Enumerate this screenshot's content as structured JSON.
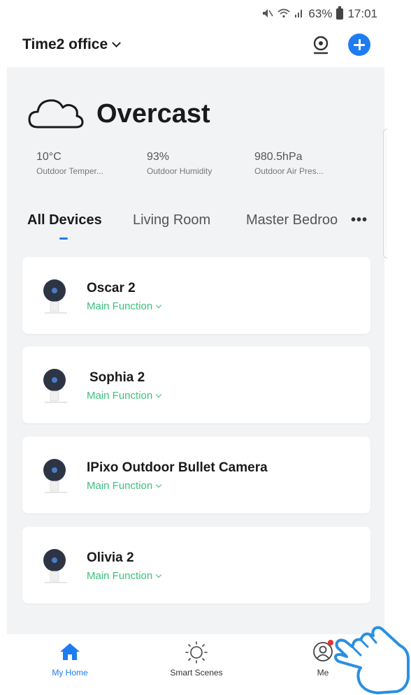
{
  "status_bar": {
    "battery": "63%",
    "time": "17:01"
  },
  "header": {
    "home_name": "Time2 office"
  },
  "weather": {
    "condition": "Overcast",
    "stats": [
      {
        "value": "10°C",
        "label": "Outdoor Temper..."
      },
      {
        "value": "93%",
        "label": "Outdoor Humidity"
      },
      {
        "value": "980.5hPa",
        "label": "Outdoor Air Pres..."
      }
    ]
  },
  "tabs": [
    "All Devices",
    "Living Room",
    "Master Bedroo"
  ],
  "devices": [
    {
      "name": "Oscar 2",
      "function": "Main Function"
    },
    {
      "name": "Sophia 2",
      "function": "Main Function"
    },
    {
      "name": "IPixo Outdoor Bullet Camera",
      "function": "Main Function"
    },
    {
      "name": "Olivia 2",
      "function": "Main Function"
    }
  ],
  "bottom_nav": [
    {
      "label": "My Home",
      "icon": "home-icon"
    },
    {
      "label": "Smart Scenes",
      "icon": "sun-icon"
    },
    {
      "label": "Me",
      "icon": "profile-icon"
    }
  ],
  "colors": {
    "accent": "#1e7cf2",
    "function_green": "#3cbf7d",
    "notification": "#e5322b"
  }
}
